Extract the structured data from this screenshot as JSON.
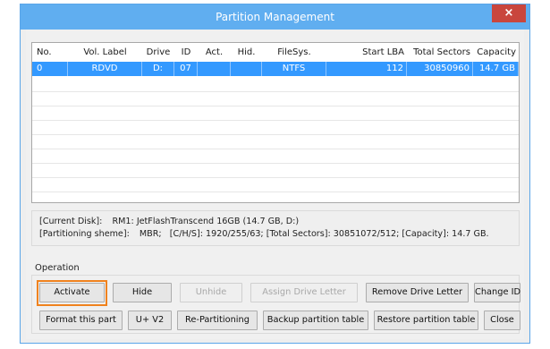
{
  "window": {
    "title": "Partition Management",
    "close_label": "×"
  },
  "table": {
    "headers": [
      "No.",
      "Vol. Label",
      "Drive",
      "ID",
      "Act.",
      "Hid.",
      "FileSys.",
      "Start LBA",
      "Total Sectors",
      "Capacity"
    ],
    "rows": [
      [
        "0",
        "RDVD",
        "D:",
        "07",
        "",
        "",
        "NTFS",
        "112",
        "30850960",
        "14.7 GB"
      ]
    ]
  },
  "info": {
    "current_disk_label": "[Current Disk]:",
    "current_disk_value": "RM1: JetFlashTranscend 16GB (14.7 GB, D:)",
    "partitioning_label": "[Partitioning sheme]:",
    "partitioning_value": "MBR;   [C/H/S]: 1920/255/63; [Total Sectors]: 30851072/512; [Capacity]: 14.7 GB."
  },
  "operation": {
    "group_label": "Operation",
    "row1": {
      "activate": "Activate",
      "hide": "Hide",
      "unhide": "Unhide",
      "assign_drive_letter": "Assign Drive Letter",
      "remove_drive_letter": "Remove Drive Letter",
      "change_id": "Change ID"
    },
    "row2": {
      "format": "Format this part",
      "u_v2": "U+ V2",
      "repartitioning": "Re-Partitioning",
      "backup": "Backup partition table",
      "restore": "Restore partition table",
      "close": "Close"
    }
  },
  "colors": {
    "title_bar": "#60aef0",
    "selection": "#3399ff",
    "close_button": "#c9463d",
    "focus_highlight": "#f0821e"
  }
}
